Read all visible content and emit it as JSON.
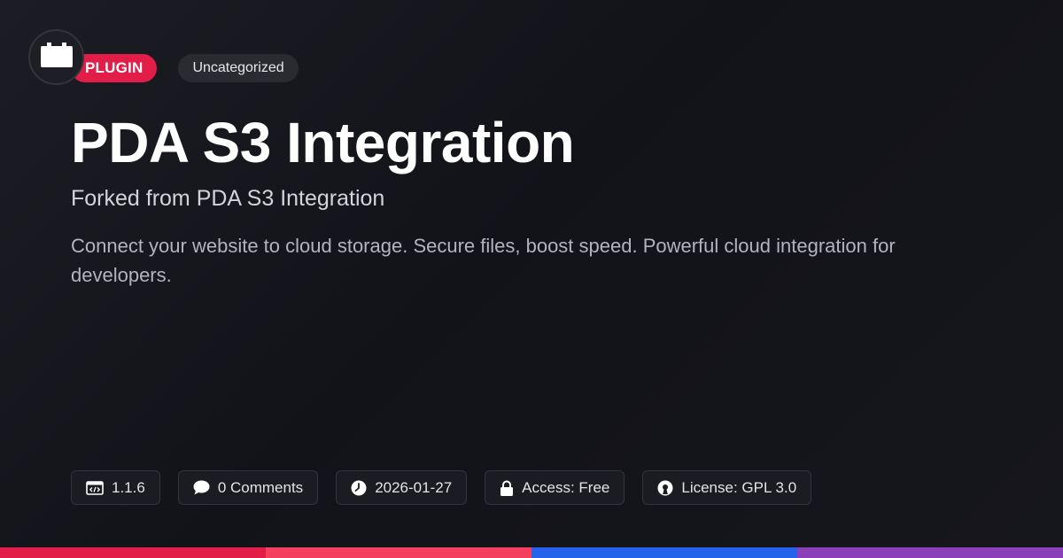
{
  "header": {
    "logo_icon": "plugin-box-icon",
    "badge_type": "PLUGIN",
    "badge_category": "Uncategorized"
  },
  "main": {
    "title": "PDA S3 Integration",
    "subtitle": "Forked from PDA S3 Integration",
    "description": "Connect your website to cloud storage. Secure files, boost speed. Powerful cloud integration for developers."
  },
  "meta": {
    "version": "1.1.6",
    "comments": "0 Comments",
    "date": "2026-01-27",
    "access": "Access: Free",
    "license": "License: GPL 3.0"
  },
  "colors": {
    "accent": "#e11d48",
    "bar_colors": [
      "#e11d48",
      "#f43f5e",
      "#2563eb",
      "#8b3fb8"
    ]
  }
}
